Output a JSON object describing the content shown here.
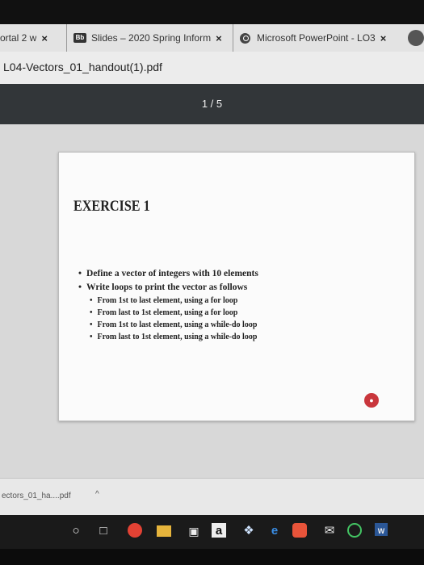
{
  "tabs": [
    {
      "title": "ortal 2 w",
      "close": "×"
    },
    {
      "favicon": "Bb",
      "title": "Slides – 2020 Spring Inform",
      "close": "×"
    },
    {
      "title": "Microsoft PowerPoint - LO3",
      "close": "×"
    }
  ],
  "document": {
    "filename": "L04-Vectors_01_handout(1).pdf"
  },
  "pdf_viewer": {
    "page_counter": "1 / 5"
  },
  "slide": {
    "title": "EXERCISE 1",
    "bullets": [
      "Define a vector of integers with 10 elements",
      "Write loops to print the vector as follows"
    ],
    "sub_bullets": [
      "From 1st to last element, using a for loop",
      "From last to 1st element, using a for loop",
      "From 1st to last element, using a while-do loop",
      "From last to 1st element, using a while-do loop"
    ]
  },
  "downloads": {
    "item": "ectors_01_ha....pdf",
    "caret": "^"
  },
  "taskbar": {
    "icons": [
      "search-icon",
      "task-view-icon",
      "chrome-icon",
      "file-explorer-icon",
      "store-icon",
      "amazon-icon",
      "dropbox-icon",
      "edge-icon",
      "office-icon",
      "mail-icon",
      "spotify-icon",
      "word-icon"
    ],
    "amazon_label": "a",
    "word_label": "W"
  },
  "colors": {
    "toolbar": "#323639",
    "badge": "#c9363c"
  }
}
